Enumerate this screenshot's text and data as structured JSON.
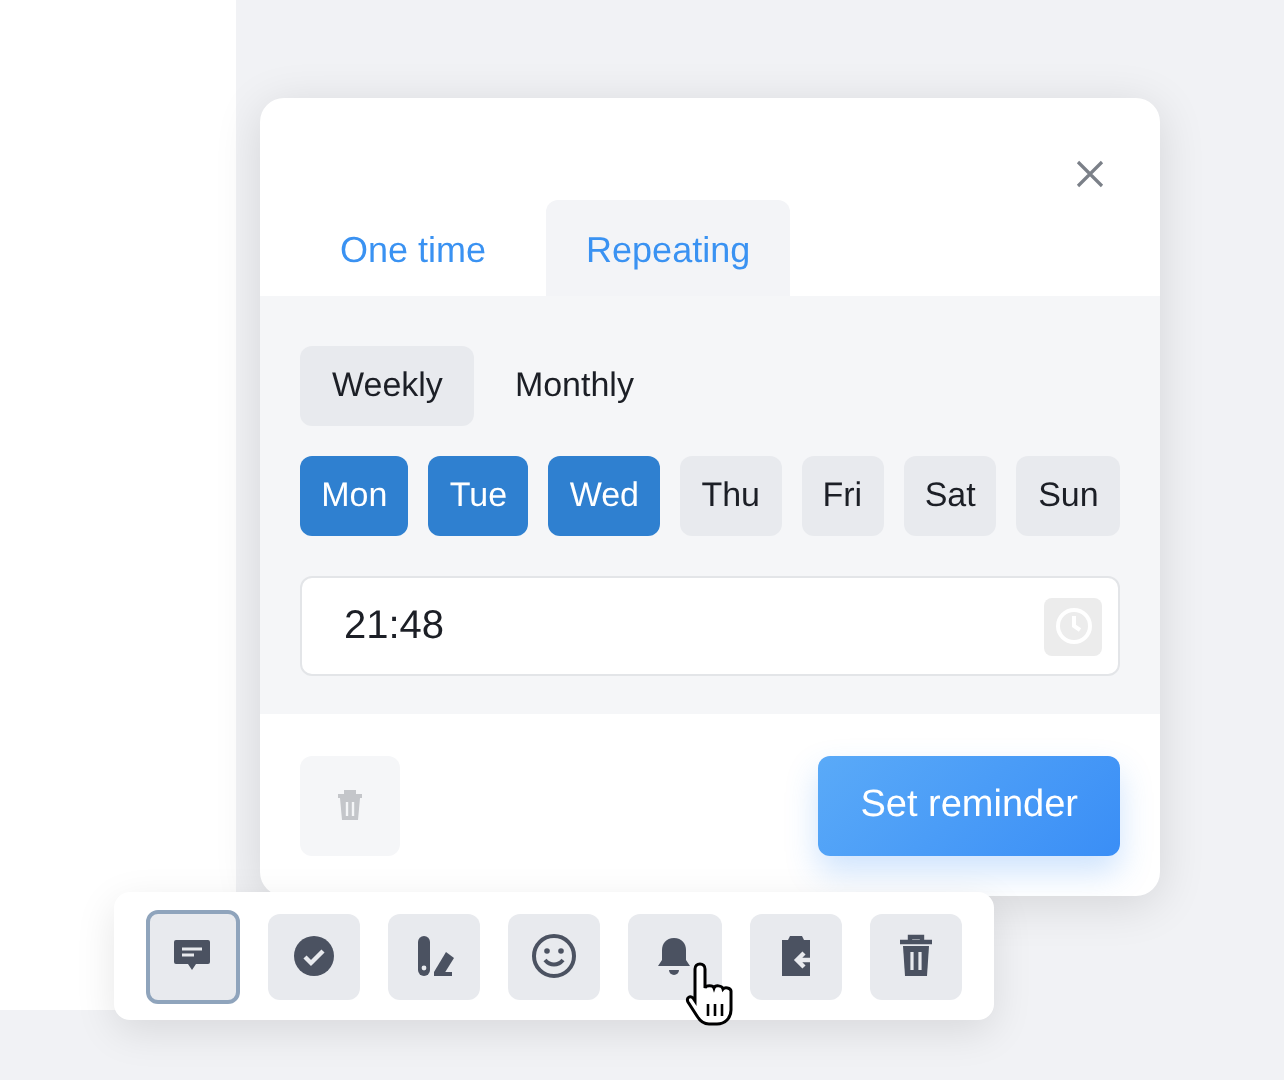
{
  "tabs": [
    {
      "label": "One time",
      "selected": false
    },
    {
      "label": "Repeating",
      "selected": true
    }
  ],
  "frequency": [
    {
      "label": "Weekly",
      "selected": true
    },
    {
      "label": "Monthly",
      "selected": false
    }
  ],
  "days": [
    {
      "label": "Mon",
      "selected": true
    },
    {
      "label": "Tue",
      "selected": true
    },
    {
      "label": "Wed",
      "selected": true
    },
    {
      "label": "Thu",
      "selected": false
    },
    {
      "label": "Fri",
      "selected": false
    },
    {
      "label": "Sat",
      "selected": false
    },
    {
      "label": "Sun",
      "selected": false
    }
  ],
  "time_field": {
    "value": "21:48"
  },
  "delete_button": {
    "disabled": true
  },
  "submit_button": {
    "label": "Set reminder"
  },
  "toolbar": [
    {
      "kind": "comment",
      "selected": true
    },
    {
      "kind": "check",
      "selected": false
    },
    {
      "kind": "style",
      "selected": false
    },
    {
      "kind": "emoji",
      "selected": false
    },
    {
      "kind": "bell",
      "selected": false
    },
    {
      "kind": "clipboard",
      "selected": false
    },
    {
      "kind": "trash",
      "selected": false
    }
  ]
}
